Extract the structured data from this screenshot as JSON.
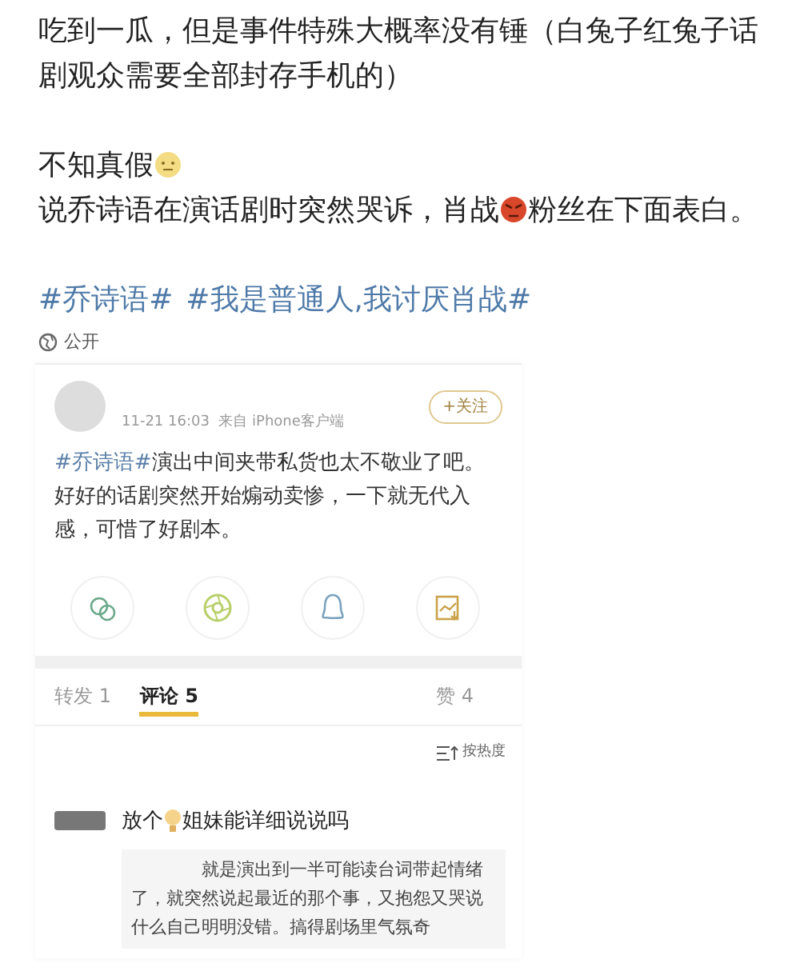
{
  "post": {
    "lines": [
      [
        {
          "kind": "text",
          "text": "吃到一瓜，但是事件特殊大概率没有锤（白兔子红兔子话剧观众需要全部封存手机的）"
        }
      ],
      [
        {
          "kind": "text",
          "text": "不知真假"
        },
        {
          "kind": "smile-emoji"
        }
      ],
      [
        {
          "kind": "text",
          "text": "说乔诗语在演话剧时突然哭诉，肖战"
        },
        {
          "kind": "angry-emoji"
        },
        {
          "kind": "text",
          "text": "粉丝在下面表白。"
        }
      ]
    ],
    "hashtags": [
      "#乔诗语#",
      "#我是普通人,我讨厌肖战#"
    ],
    "visibility": "公开"
  },
  "card": {
    "follow_button": "+关注",
    "meta": "11-21 16:03  来自 iPhone客户端",
    "text": [
      {
        "kind": "tag",
        "text": "#乔诗语#"
      },
      {
        "kind": "text",
        "text": "演出中间夹带私货也太不敬业了吧。好好的话剧突然开始煽动卖惨，一下就无代入感，可惜了好剧本。"
      }
    ],
    "share": [
      {
        "kind": "wechat"
      },
      {
        "kind": "moments"
      },
      {
        "kind": "qq"
      },
      {
        "kind": "save"
      }
    ],
    "tabs": [
      {
        "label": "转发 1",
        "selected": false
      },
      {
        "label": "评论 5",
        "selected": true
      },
      {
        "label": "赞 4",
        "selected": false
      }
    ],
    "sort": "按热度",
    "comment": {
      "text": [
        {
          "kind": "text",
          "text": "放个"
        },
        {
          "kind": "bulb-emoji"
        },
        {
          "kind": "text",
          "text": " 姐妹能详细说说吗"
        }
      ],
      "reply": "就是演出到一半可能读台词带起情绪了，就突然说起最近的那个事，又抱怨又哭说什么自己明明没错。搞得剧场里气氛奇"
    }
  }
}
